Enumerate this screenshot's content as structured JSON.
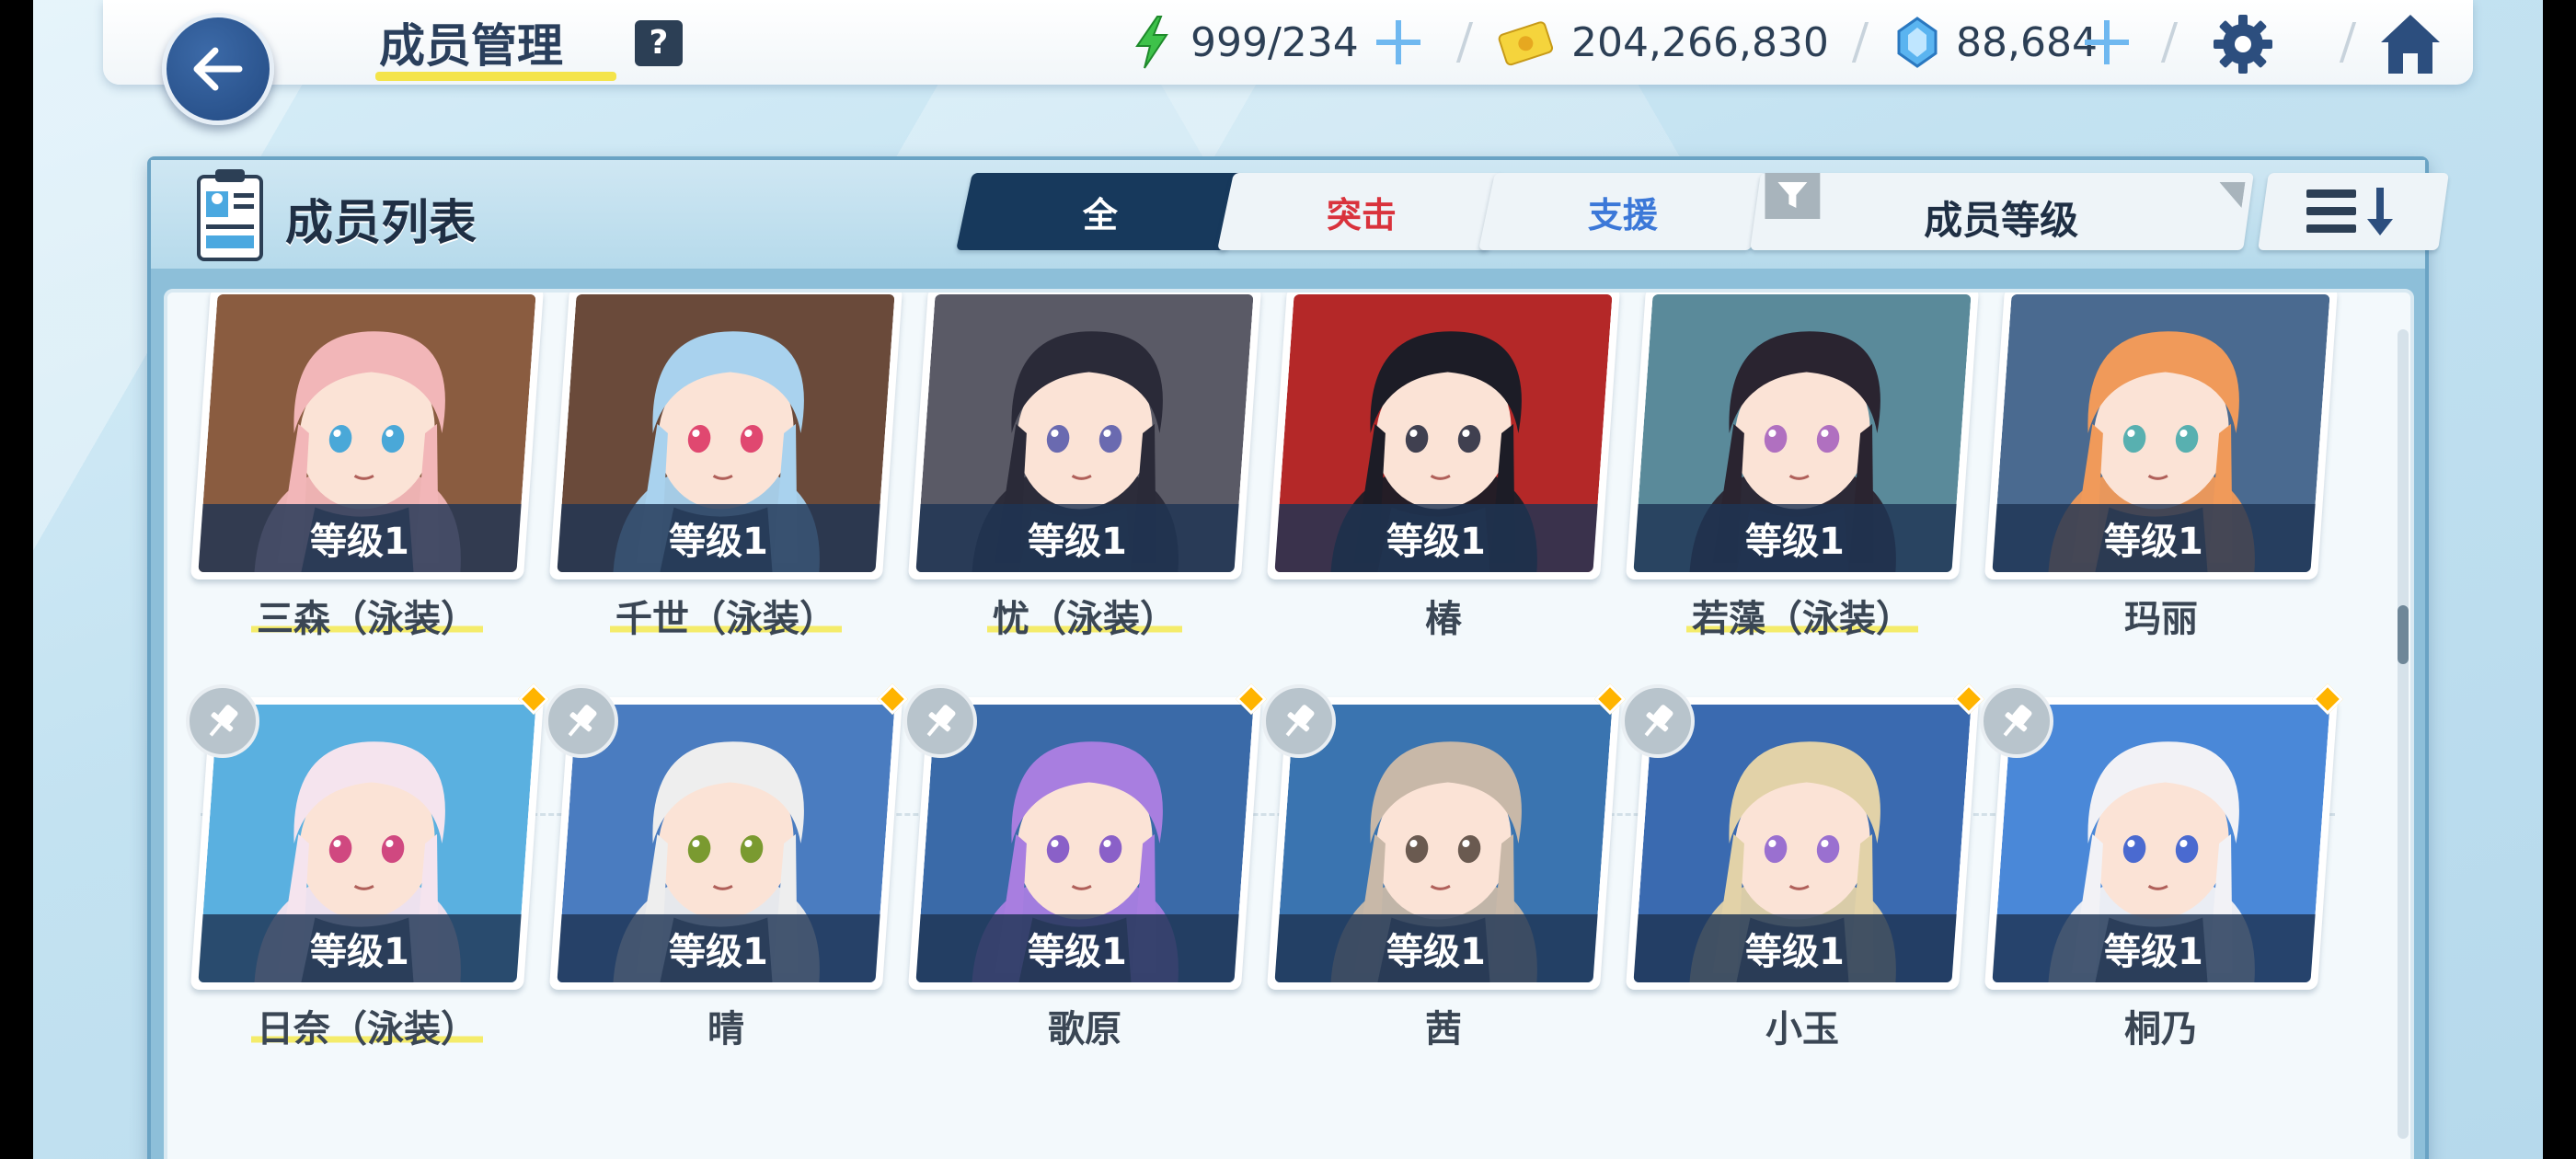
{
  "header": {
    "title": "成员管理",
    "help_label": "?",
    "ap": "999/234",
    "credits": "204,266,830",
    "gems": "88,684"
  },
  "panel": {
    "title": "成员列表",
    "tabs": [
      {
        "label": "全",
        "active": true
      },
      {
        "label": "突击",
        "active": false
      },
      {
        "label": "支援",
        "active": false
      }
    ],
    "sort_label": "成员等级"
  },
  "members_row1": [
    {
      "level": "等级1",
      "name": "三森（泳装）",
      "hair": "#f2b6b8",
      "bg": "#8a5c40",
      "eye": "#4aa8d8"
    },
    {
      "level": "等级1",
      "name": "千世（泳装）",
      "hair": "#a9d2ee",
      "bg": "#6a4a3a",
      "eye": "#e04870"
    },
    {
      "level": "等级1",
      "name": "忧（泳装）",
      "hair": "#2a2a38",
      "bg": "#5a5a66",
      "eye": "#6a6ab0"
    },
    {
      "level": "等级1",
      "name": "椿",
      "hair": "#1c1c26",
      "bg": "#b42828",
      "eye": "#404050"
    },
    {
      "level": "等级1",
      "name": "若藻（泳装）",
      "hair": "#2a2430",
      "bg": "#5a8a9a",
      "eye": "#b070c0"
    },
    {
      "level": "等级1",
      "name": "玛丽",
      "hair": "#f09a5a",
      "bg": "#4a6a90",
      "eye": "#58b0b0"
    }
  ],
  "members_row2": [
    {
      "level": "等级1",
      "name": "日奈（泳装）",
      "hair": "#f5e4ee",
      "bg": "#5ab0e0",
      "eye": "#d04880"
    },
    {
      "level": "等级1",
      "name": "晴",
      "hair": "#eeeeee",
      "bg": "#4a7cc0",
      "eye": "#7a9a30"
    },
    {
      "level": "等级1",
      "name": "歌原",
      "hair": "#a87ee0",
      "bg": "#3a6aa8",
      "eye": "#8a60c8"
    },
    {
      "level": "等级1",
      "name": "茜",
      "hair": "#c8b8a8",
      "bg": "#3a74b0",
      "eye": "#6a5a50"
    },
    {
      "level": "等级1",
      "name": "小玉",
      "hair": "#e2d2a8",
      "bg": "#3a6ab0",
      "eye": "#9a70d0"
    },
    {
      "level": "等级1",
      "name": "桐乃",
      "hair": "#f2f2f6",
      "bg": "#4a88d8",
      "eye": "#4a6ad0"
    }
  ]
}
